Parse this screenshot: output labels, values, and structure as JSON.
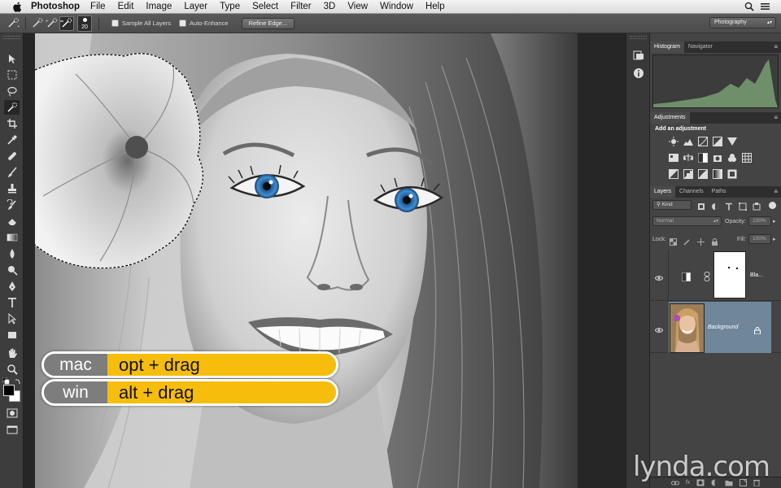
{
  "menubar": {
    "app_name": "Photoshop",
    "items": [
      "File",
      "Edit",
      "Image",
      "Layer",
      "Type",
      "Select",
      "Filter",
      "3D",
      "View",
      "Window",
      "Help"
    ]
  },
  "options": {
    "brush_size": "20",
    "sample_all_layers": "Sample All Layers",
    "auto_enhance": "Auto-Enhance",
    "refine_edge": "Refine Edge...",
    "workspace": "Photography"
  },
  "panels": {
    "histogram_tabs": [
      "Histogram",
      "Navigator"
    ],
    "adjustments_tab": "Adjustments",
    "adjustments_hint": "Add an adjustment",
    "layers_tabs": [
      "Layers",
      "Channels",
      "Paths"
    ],
    "kind_filter": "Kind",
    "blend_mode": "Normal",
    "opacity_label": "Opacity:",
    "opacity_value": "100%",
    "lock_label": "Lock:",
    "fill_label": "Fill:",
    "fill_value": "100%",
    "layers": [
      {
        "name": "Bla..."
      },
      {
        "name": "Background"
      }
    ]
  },
  "overlay": {
    "mac_label": "mac",
    "mac_keys": "opt + drag",
    "win_label": "win",
    "win_keys": "alt + drag"
  },
  "watermark": "lynda.com",
  "colors": {
    "accent_yellow": "#f6bd0c",
    "os_label_gray": "#7d7d7d",
    "selected_layer": "#6f8799",
    "eye_blue": "#3d8fd4"
  }
}
